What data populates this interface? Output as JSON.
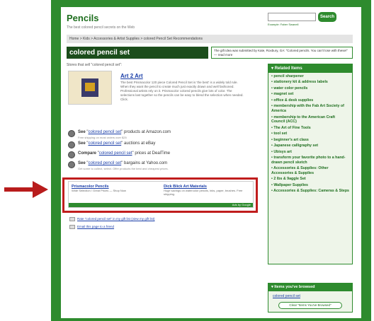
{
  "site": {
    "logo": "Pencils",
    "tagline": "The best colored pencil secrets on the Web",
    "search_button": "Search",
    "search_links": "Example: Faber Swanell"
  },
  "breadcrumb": "Home > Kids > Accessories & Artist Supplies > colored Pencil Set Recommendations",
  "category": {
    "title": "colored pencil set",
    "submit_note": "The gift idea was submitted by Kate, Roxbury, GA: \"Colored pencils. You can't lose with these!\" — read more",
    "intro": "Stores that sell \"colored pencil set\":"
  },
  "product": {
    "title": "Art 2 Art",
    "description": "The best Prismacolor 120 piece Colored Pencil Set is 'the best' is a widely told rule. When they want the pencil to create much just exactly drawn and well fashioned. Professional artists rely on it. Prismacolor colored pencils give lots of color. The selections last together so the pencils can be easy to blend the selection when needed. Click."
  },
  "see_rows": [
    {
      "prefix": "See",
      "link": "colored pencil set",
      "suffix": "products at Amazon.com",
      "sub": "Free shipping on most orders over $25"
    },
    {
      "prefix": "See",
      "link": "colored pencil set",
      "suffix": "auctions at eBay",
      "sub": ""
    },
    {
      "prefix": "Compare",
      "link": "colored pencil set",
      "suffix": "prices at DealTime",
      "sub": ""
    },
    {
      "prefix": "See",
      "link": "colored pencil set",
      "suffix": "bargains at Yahoo.com",
      "sub": "Get some to collect, select. Offer products the best and cheapest prices."
    }
  ],
  "ads": [
    {
      "title": "Prismacolor Pencils",
      "desc": "Wide Selection / Great Prices — Shop Now"
    },
    {
      "title": "Dick Blick Art Materials",
      "desc": "Huge savings on watercolor pencils, inks, paper, brushes. Free shipping."
    }
  ],
  "ads_label": "Ads by Google",
  "footer_links": [
    "Rate \"colored pencil set\" in my gift list (view my gift list)",
    "Email this page to a friend"
  ],
  "sidebar": {
    "title": "Related Items",
    "items": [
      "pencil sharpener",
      "stationery kit & address labels",
      "water color pencils",
      "magnet set",
      "office & desk supplies",
      "membership with the Fab Art Society of America",
      "membership to the American Craft Council (ACC)",
      "The Art of Fine Tools",
      "tool set",
      "beginner's art class",
      "Japanese calligraphy set",
      "Ubisys art",
      "transform your favorite photo to a hand-drawn pencil sketch",
      "Accessories & Supplies: Other Accessories & Supplies",
      "2 lbs & 9aggle Set",
      "Wallpaper Supplies",
      "Accessories & Supplies: Cameras & Steps"
    ]
  },
  "browsed": {
    "title": "Items you've browsed",
    "item": "colored pencil set",
    "button": "Clear \"Items You've Browsed\""
  },
  "colors": {
    "frame_green": "#2e8b2e",
    "title_bar": "#1b4d1b",
    "highlight_red": "#c01d1d",
    "link_blue": "#1a3ea8"
  }
}
